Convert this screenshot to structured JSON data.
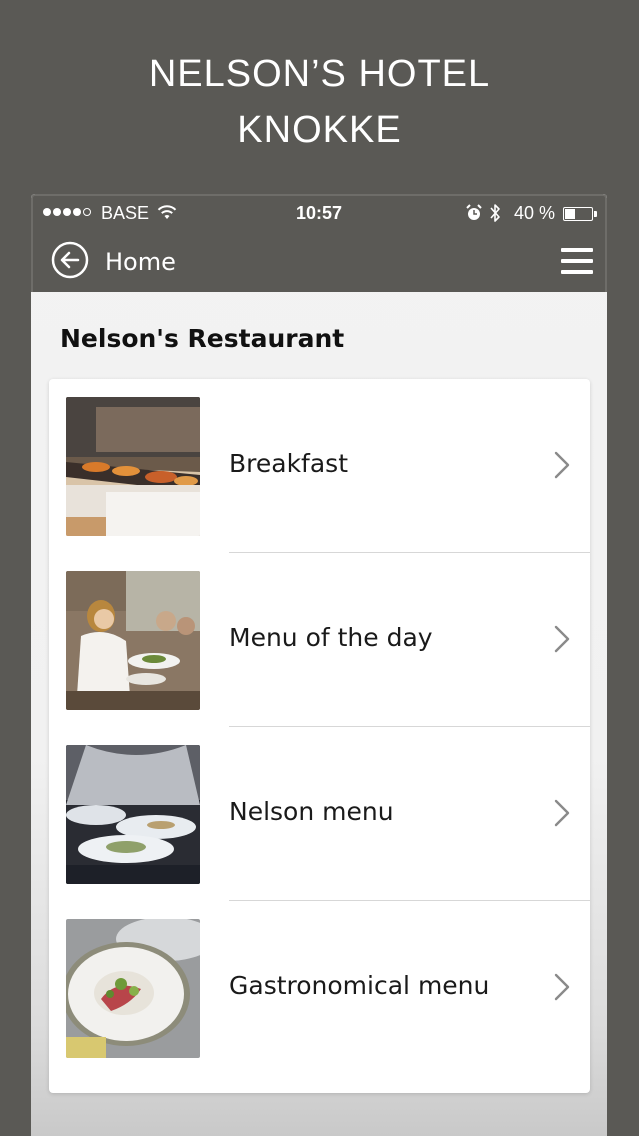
{
  "promo": {
    "title_line1": "NELSON’S HOTEL",
    "title_line2": "KNOKKE"
  },
  "status_bar": {
    "carrier": "BASE",
    "time": "10:57",
    "battery": "40 %",
    "battery_level": 0.4,
    "signal_bars": 4,
    "signal_max": 5
  },
  "nav": {
    "back_label": "Home",
    "back_icon": "back-arrow-circle-icon",
    "menu_icon": "hamburger-menu-icon"
  },
  "page": {
    "section_title": "Nelson's Restaurant"
  },
  "menu_items": [
    {
      "label": "Breakfast",
      "image": "breakfast-buffet-photo"
    },
    {
      "label": "Menu of the day",
      "image": "waitress-serving-photo"
    },
    {
      "label": "Nelson menu",
      "image": "chefs-plating-photo"
    },
    {
      "label": "Gastronomical menu",
      "image": "gourmet-plate-photo"
    }
  ],
  "colors": {
    "background": "#5a5955",
    "header": "#5a5955",
    "card": "#ffffff",
    "text": "#1a1a1a",
    "chevron": "#8a8a8a"
  }
}
